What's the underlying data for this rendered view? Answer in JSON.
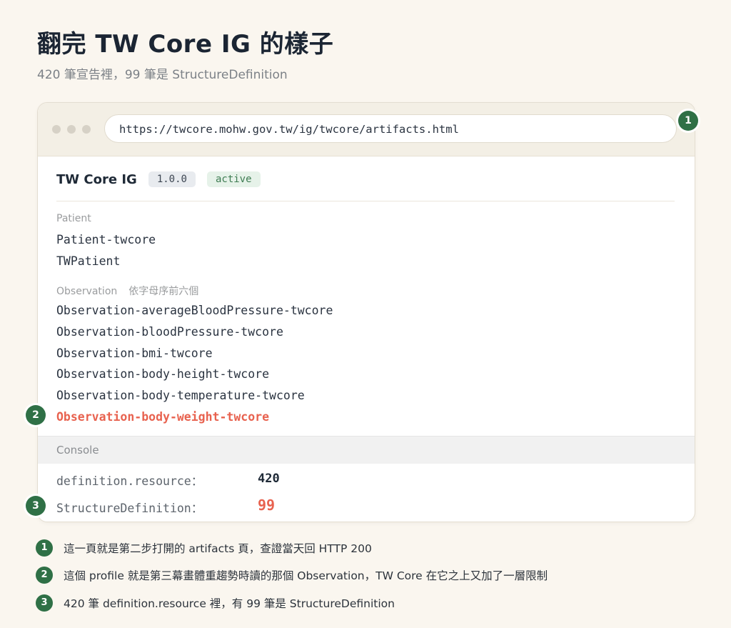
{
  "page": {
    "title": "翻完 TW Core IG 的樣子",
    "subtitle": "420 筆宣告裡，99 筆是 StructureDefinition"
  },
  "browser": {
    "url": "https://twcore.mohw.gov.tw/ig/twcore/artifacts.html",
    "ig_name": "TW Core IG",
    "version": "1.0.0",
    "status": "active",
    "sections": [
      {
        "label": "Patient",
        "note": "",
        "items": [
          "Patient-twcore",
          "TWPatient"
        ]
      },
      {
        "label": "Observation",
        "note": "依字母序前六個",
        "items": [
          "Observation-averageBloodPressure-twcore",
          "Observation-bloodPressure-twcore",
          "Observation-bmi-twcore",
          "Observation-body-height-twcore",
          "Observation-body-temperature-twcore",
          "Observation-body-weight-twcore"
        ],
        "highlighted_item": "Observation-body-weight-twcore"
      }
    ],
    "console": {
      "label": "Console",
      "rows": [
        {
          "key": "definition.resource：",
          "value": "420"
        },
        {
          "key": "StructureDefinition：",
          "value": "99"
        }
      ]
    }
  },
  "markers": [
    "1",
    "2",
    "3"
  ],
  "notes": [
    {
      "num": "1",
      "text": "這一頁就是第二步打開的 artifacts 頁，查證當天回 HTTP 200"
    },
    {
      "num": "2",
      "text": "這個 profile 就是第三幕畫體重趨勢時讀的那個 Observation，TW Core 在它之上又加了一層限制"
    },
    {
      "num": "3",
      "text": "420 筆 definition.resource 裡，有 99 筆是 StructureDefinition"
    }
  ],
  "colors": {
    "accent_green": "#2f7046",
    "highlight_red": "#e8624f",
    "background": "#faf6ef"
  }
}
